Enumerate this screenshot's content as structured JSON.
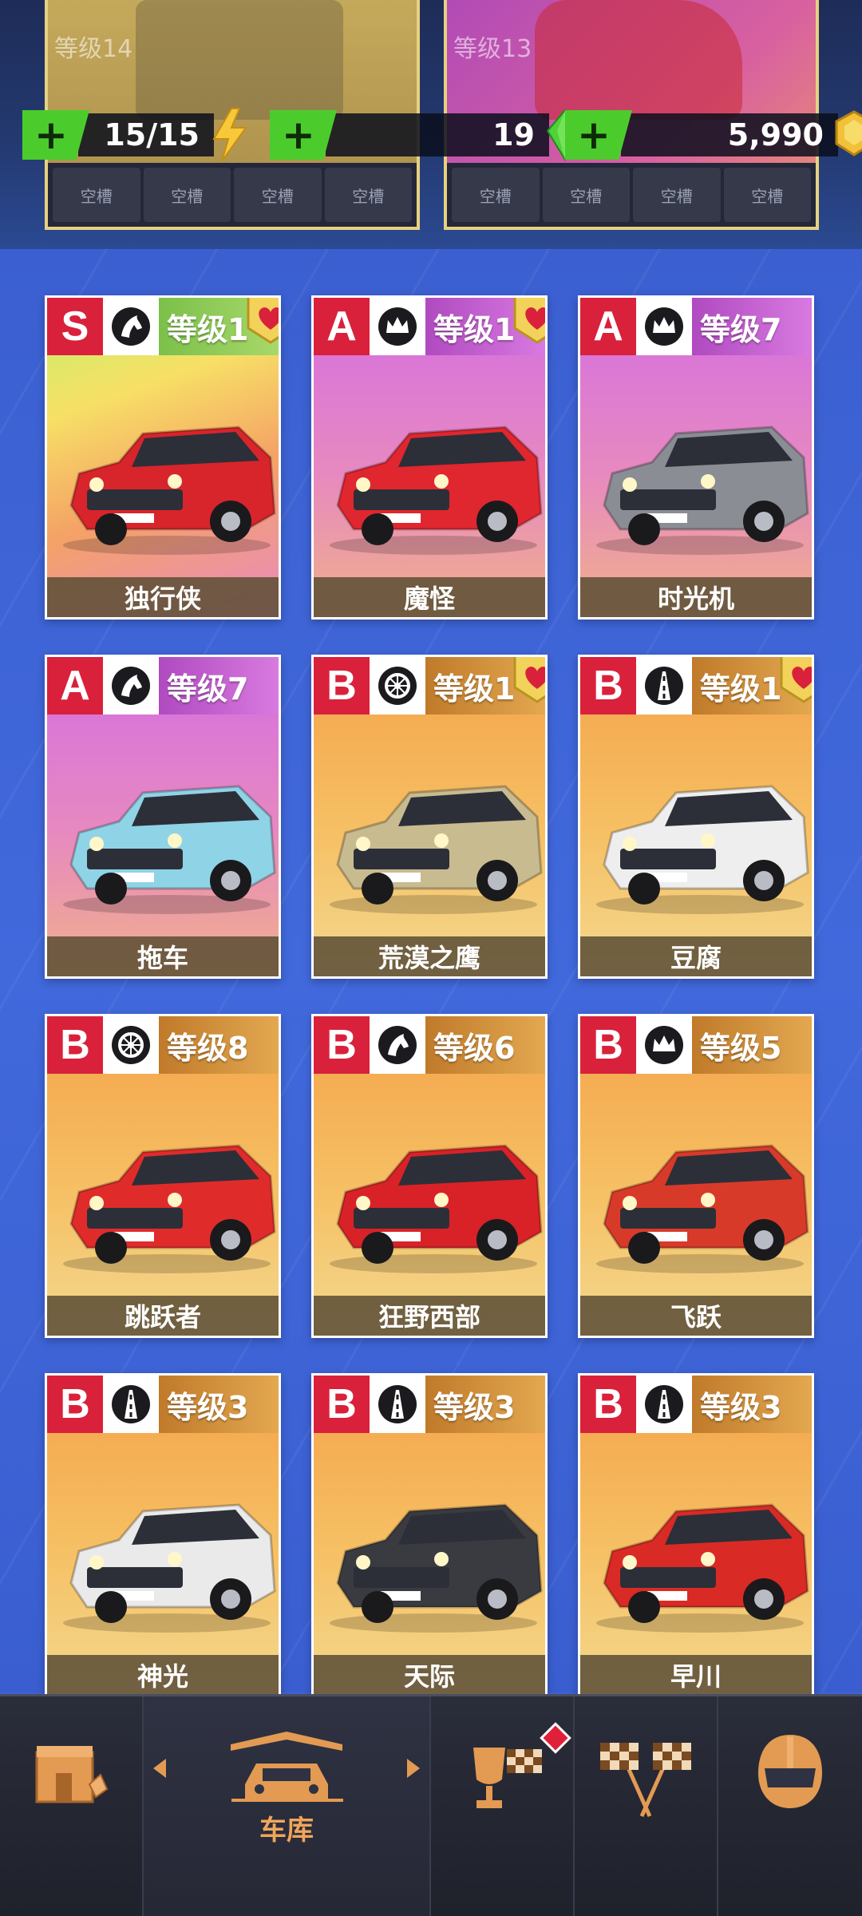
{
  "top_cards": [
    {
      "level_label": "等级14",
      "slot_label": "空槽"
    },
    {
      "level_label": "等级13",
      "slot_label": "空槽"
    }
  ],
  "resources": {
    "energy": "15/15",
    "gems": "19",
    "coins": "5,990",
    "plus": "+"
  },
  "cars": [
    {
      "rank": "S",
      "class_icon": "horse-icon",
      "level": "等级1",
      "name": "独行侠",
      "favorite": true,
      "theme": "rainbow",
      "car_color": "#d8242b"
    },
    {
      "rank": "A",
      "class_icon": "crown-icon",
      "level": "等级1",
      "name": "魔怪",
      "favorite": true,
      "theme": "purple",
      "car_color": "#e0262f"
    },
    {
      "rank": "A",
      "class_icon": "crown-icon",
      "level": "等级7",
      "name": "时光机",
      "favorite": false,
      "theme": "purple",
      "car_color": "#8a8d94"
    },
    {
      "rank": "A",
      "class_icon": "horse-icon",
      "level": "等级7",
      "name": "拖车",
      "favorite": false,
      "theme": "purple",
      "car_color": "#8fd3e6"
    },
    {
      "rank": "B",
      "class_icon": "wheel-icon",
      "level": "等级1",
      "name": "荒漠之鹰",
      "favorite": true,
      "theme": "orange",
      "car_color": "#c9bb90"
    },
    {
      "rank": "B",
      "class_icon": "road-icon",
      "level": "等级1",
      "name": "豆腐",
      "favorite": true,
      "theme": "orange",
      "car_color": "#eeeeee"
    },
    {
      "rank": "B",
      "class_icon": "wheel-icon",
      "level": "等级8",
      "name": "跳跃者",
      "favorite": false,
      "theme": "orange",
      "car_color": "#e02b2b"
    },
    {
      "rank": "B",
      "class_icon": "horse-icon",
      "level": "等级6",
      "name": "狂野西部",
      "favorite": false,
      "theme": "orange",
      "car_color": "#d82228"
    },
    {
      "rank": "B",
      "class_icon": "crown-icon",
      "level": "等级5",
      "name": "飞跃",
      "favorite": false,
      "theme": "orange",
      "car_color": "#d83a2a"
    },
    {
      "rank": "B",
      "class_icon": "road-icon",
      "level": "等级3",
      "name": "神光",
      "favorite": false,
      "theme": "orange",
      "car_color": "#eaeaea"
    },
    {
      "rank": "B",
      "class_icon": "road-icon",
      "level": "等级3",
      "name": "天际",
      "favorite": false,
      "theme": "orange",
      "car_color": "#3a3b40"
    },
    {
      "rank": "B",
      "class_icon": "road-icon",
      "level": "等级3",
      "name": "早川",
      "favorite": false,
      "theme": "orange",
      "car_color": "#d92a26"
    }
  ],
  "nav": {
    "items": [
      "shop-icon",
      "garage-icon",
      "trophy-icon",
      "race-flags-icon",
      "helmet-icon"
    ],
    "garage_label": "车库",
    "active": "garage"
  },
  "colors": {
    "background": "#3d63d4",
    "rank_red": "#d9213b",
    "accent_orange": "#e39a52",
    "plus_green": "#4ccc2c"
  }
}
